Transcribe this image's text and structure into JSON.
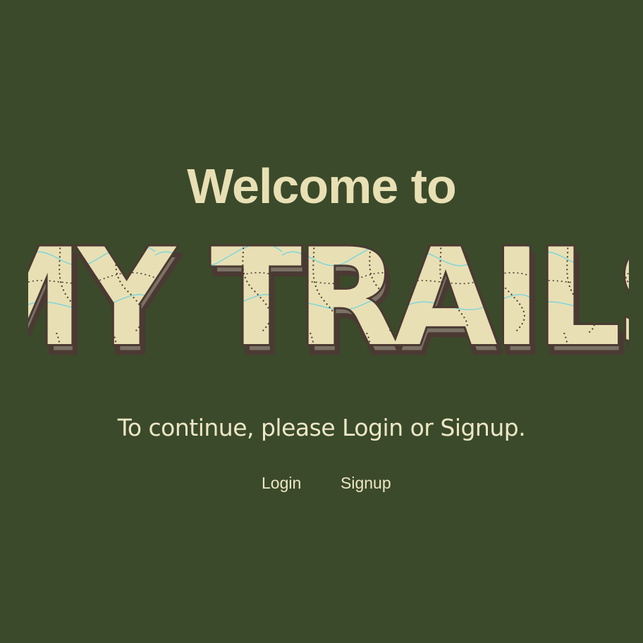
{
  "header": {
    "welcome_text": "Welcome to"
  },
  "logo": {
    "text": "MY TRAILS",
    "icon": "topographic-map-lettering"
  },
  "main": {
    "subtitle": "To continue, please Login or Signup."
  },
  "nav": {
    "login_label": "Login",
    "signup_label": "Signup"
  },
  "colors": {
    "background": "#3b4a2a",
    "text": "#ece7c7",
    "logo_fill": "#e8e0b4",
    "logo_outline": "#4b3a33",
    "logo_shadow": "#7a7264",
    "map_water": "#7fd6dc",
    "map_trail": "#4b3a33"
  }
}
